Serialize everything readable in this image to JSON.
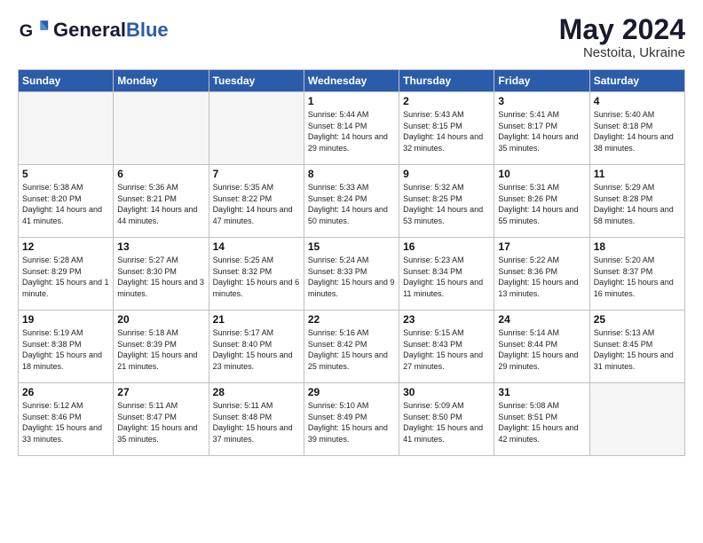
{
  "header": {
    "logo_general": "General",
    "logo_blue": "Blue",
    "month_year": "May 2024",
    "location": "Nestoita, Ukraine"
  },
  "weekdays": [
    "Sunday",
    "Monday",
    "Tuesday",
    "Wednesday",
    "Thursday",
    "Friday",
    "Saturday"
  ],
  "weeks": [
    [
      {
        "day": "",
        "empty": true
      },
      {
        "day": "",
        "empty": true
      },
      {
        "day": "",
        "empty": true
      },
      {
        "day": "1",
        "sunrise": "5:44 AM",
        "sunset": "8:14 PM",
        "daylight": "14 hours and 29 minutes."
      },
      {
        "day": "2",
        "sunrise": "5:43 AM",
        "sunset": "8:15 PM",
        "daylight": "14 hours and 32 minutes."
      },
      {
        "day": "3",
        "sunrise": "5:41 AM",
        "sunset": "8:17 PM",
        "daylight": "14 hours and 35 minutes."
      },
      {
        "day": "4",
        "sunrise": "5:40 AM",
        "sunset": "8:18 PM",
        "daylight": "14 hours and 38 minutes."
      }
    ],
    [
      {
        "day": "5",
        "sunrise": "5:38 AM",
        "sunset": "8:20 PM",
        "daylight": "14 hours and 41 minutes."
      },
      {
        "day": "6",
        "sunrise": "5:36 AM",
        "sunset": "8:21 PM",
        "daylight": "14 hours and 44 minutes."
      },
      {
        "day": "7",
        "sunrise": "5:35 AM",
        "sunset": "8:22 PM",
        "daylight": "14 hours and 47 minutes."
      },
      {
        "day": "8",
        "sunrise": "5:33 AM",
        "sunset": "8:24 PM",
        "daylight": "14 hours and 50 minutes."
      },
      {
        "day": "9",
        "sunrise": "5:32 AM",
        "sunset": "8:25 PM",
        "daylight": "14 hours and 53 minutes."
      },
      {
        "day": "10",
        "sunrise": "5:31 AM",
        "sunset": "8:26 PM",
        "daylight": "14 hours and 55 minutes."
      },
      {
        "day": "11",
        "sunrise": "5:29 AM",
        "sunset": "8:28 PM",
        "daylight": "14 hours and 58 minutes."
      }
    ],
    [
      {
        "day": "12",
        "sunrise": "5:28 AM",
        "sunset": "8:29 PM",
        "daylight": "15 hours and 1 minute."
      },
      {
        "day": "13",
        "sunrise": "5:27 AM",
        "sunset": "8:30 PM",
        "daylight": "15 hours and 3 minutes."
      },
      {
        "day": "14",
        "sunrise": "5:25 AM",
        "sunset": "8:32 PM",
        "daylight": "15 hours and 6 minutes."
      },
      {
        "day": "15",
        "sunrise": "5:24 AM",
        "sunset": "8:33 PM",
        "daylight": "15 hours and 9 minutes."
      },
      {
        "day": "16",
        "sunrise": "5:23 AM",
        "sunset": "8:34 PM",
        "daylight": "15 hours and 11 minutes."
      },
      {
        "day": "17",
        "sunrise": "5:22 AM",
        "sunset": "8:36 PM",
        "daylight": "15 hours and 13 minutes."
      },
      {
        "day": "18",
        "sunrise": "5:20 AM",
        "sunset": "8:37 PM",
        "daylight": "15 hours and 16 minutes."
      }
    ],
    [
      {
        "day": "19",
        "sunrise": "5:19 AM",
        "sunset": "8:38 PM",
        "daylight": "15 hours and 18 minutes."
      },
      {
        "day": "20",
        "sunrise": "5:18 AM",
        "sunset": "8:39 PM",
        "daylight": "15 hours and 21 minutes."
      },
      {
        "day": "21",
        "sunrise": "5:17 AM",
        "sunset": "8:40 PM",
        "daylight": "15 hours and 23 minutes."
      },
      {
        "day": "22",
        "sunrise": "5:16 AM",
        "sunset": "8:42 PM",
        "daylight": "15 hours and 25 minutes."
      },
      {
        "day": "23",
        "sunrise": "5:15 AM",
        "sunset": "8:43 PM",
        "daylight": "15 hours and 27 minutes."
      },
      {
        "day": "24",
        "sunrise": "5:14 AM",
        "sunset": "8:44 PM",
        "daylight": "15 hours and 29 minutes."
      },
      {
        "day": "25",
        "sunrise": "5:13 AM",
        "sunset": "8:45 PM",
        "daylight": "15 hours and 31 minutes."
      }
    ],
    [
      {
        "day": "26",
        "sunrise": "5:12 AM",
        "sunset": "8:46 PM",
        "daylight": "15 hours and 33 minutes."
      },
      {
        "day": "27",
        "sunrise": "5:11 AM",
        "sunset": "8:47 PM",
        "daylight": "15 hours and 35 minutes."
      },
      {
        "day": "28",
        "sunrise": "5:11 AM",
        "sunset": "8:48 PM",
        "daylight": "15 hours and 37 minutes."
      },
      {
        "day": "29",
        "sunrise": "5:10 AM",
        "sunset": "8:49 PM",
        "daylight": "15 hours and 39 minutes."
      },
      {
        "day": "30",
        "sunrise": "5:09 AM",
        "sunset": "8:50 PM",
        "daylight": "15 hours and 41 minutes."
      },
      {
        "day": "31",
        "sunrise": "5:08 AM",
        "sunset": "8:51 PM",
        "daylight": "15 hours and 42 minutes."
      },
      {
        "day": "",
        "empty": true
      }
    ]
  ]
}
